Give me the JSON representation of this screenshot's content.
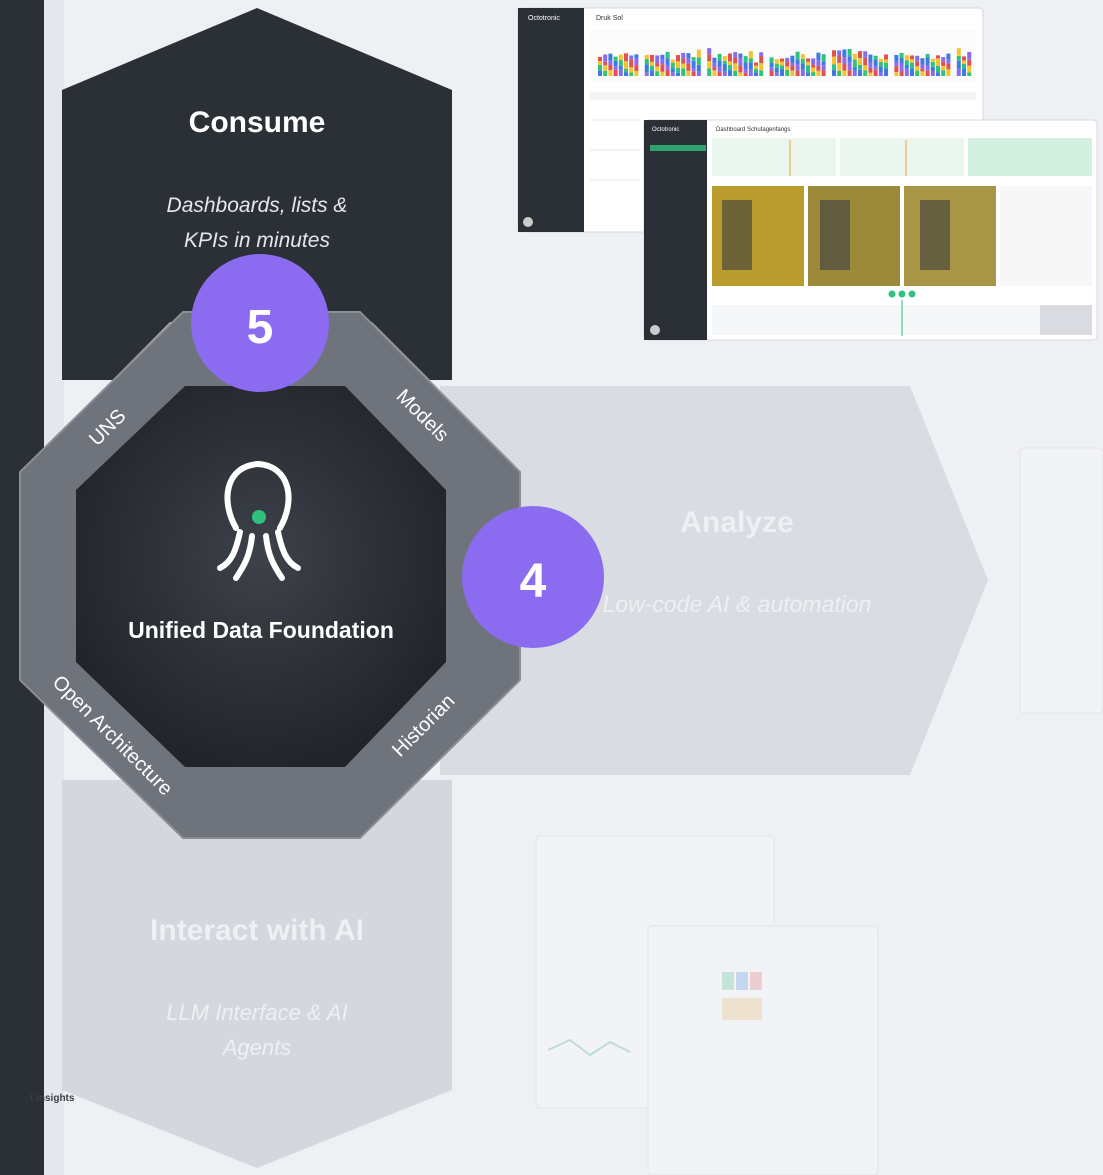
{
  "stages": {
    "consume": {
      "title": "Consume",
      "subtitle": "Dashboards, lists &",
      "subtitle2": "KPIs in minutes",
      "number": "5"
    },
    "analyze": {
      "title": "Analyze",
      "subtitle": "Low-code AI & automation",
      "number": "4"
    },
    "interact": {
      "title": "Interact with AI",
      "subtitle": "LLM Interface & AI",
      "subtitle2": "Agents"
    }
  },
  "foundation": {
    "title": "Unified Data Foundation",
    "segments": [
      "UNS",
      "Models",
      "Historian",
      "Open Architecture"
    ]
  },
  "edge_text": "t insights",
  "screens": {
    "brand": "Octotronic",
    "top_title": "Druk Sol",
    "dashboard_title": "Dashboard Schutagenfangs"
  },
  "colors": {
    "dark": "#2b2f36",
    "badge": "#8b6cf0",
    "green": "#2ec27e",
    "light_arrow": "#d9dce2",
    "ring": "#6f737b"
  }
}
